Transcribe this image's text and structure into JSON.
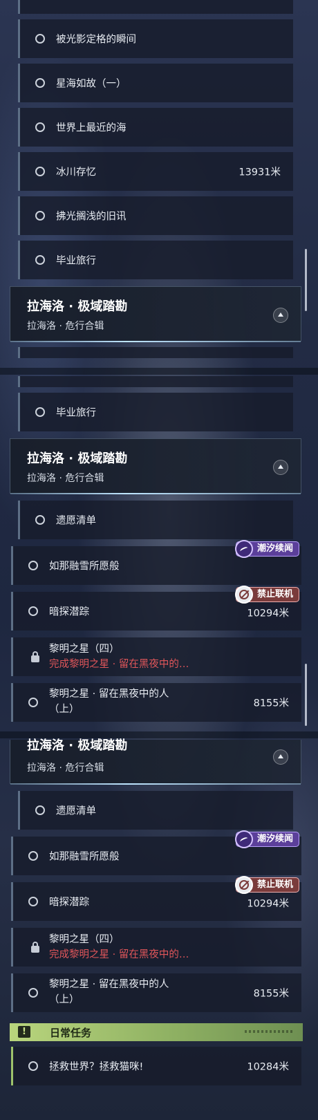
{
  "panel1": {
    "quests": [
      {
        "name": "被光影定格的瞬间",
        "distance": ""
      },
      {
        "name": "星海如故（一）",
        "distance": ""
      },
      {
        "name": "世界上最近的海",
        "distance": ""
      },
      {
        "name": "冰川存忆",
        "distance": "13931米"
      },
      {
        "name": "拂光搁浅的旧讯",
        "distance": ""
      },
      {
        "name": "毕业旅行",
        "distance": ""
      }
    ],
    "section": {
      "title": "拉海洛 · 极域踏勘",
      "subtitle": "拉海洛 · 危行合辑"
    }
  },
  "panel2": {
    "top_quest": {
      "name": "毕业旅行"
    },
    "section": {
      "title": "拉海洛 · 极域踏勘",
      "subtitle": "拉海洛 · 危行合辑"
    },
    "quests": [
      {
        "name": "遗愿清单",
        "distance": ""
      },
      {
        "name": "如那融雪所愿般",
        "distance": "",
        "badge": "潮汐续闻"
      },
      {
        "name": "暗探潜踪",
        "distance": "10294米",
        "badge": "禁止联机"
      },
      {
        "name": "黎明之星（四）",
        "status": "完成黎明之星 · 留在黑夜中的…",
        "locked": true
      },
      {
        "name_line1": "黎明之星 · 留在黑夜中的人",
        "name_line2": "（上）",
        "distance": "8155米"
      }
    ]
  },
  "panel3": {
    "section": {
      "title": "拉海洛 · 极域踏勘",
      "subtitle": "拉海洛 · 危行合辑"
    },
    "quests": [
      {
        "name": "遗愿清单",
        "distance": ""
      },
      {
        "name": "如那融雪所愿般",
        "distance": "",
        "badge": "潮汐续闻"
      },
      {
        "name": "暗探潜踪",
        "distance": "10294米",
        "badge": "禁止联机"
      },
      {
        "name": "黎明之星（四）",
        "status": "完成黎明之星 · 留在黑夜中的…",
        "locked": true
      },
      {
        "name_line1": "黎明之星 · 留在黑夜中的人",
        "name_line2": "（上）",
        "distance": "8155米"
      }
    ],
    "daily": {
      "title": "日常任务",
      "icon": "!"
    },
    "daily_quest": {
      "name": "拯救世界？拯救猫咪!",
      "distance": "10284米"
    }
  },
  "colors": {
    "accent_purple": "#5b3f9a",
    "locked_red": "#e0565a",
    "daily_green": "#9ec36b",
    "header_glow": "#bfe6ff"
  }
}
